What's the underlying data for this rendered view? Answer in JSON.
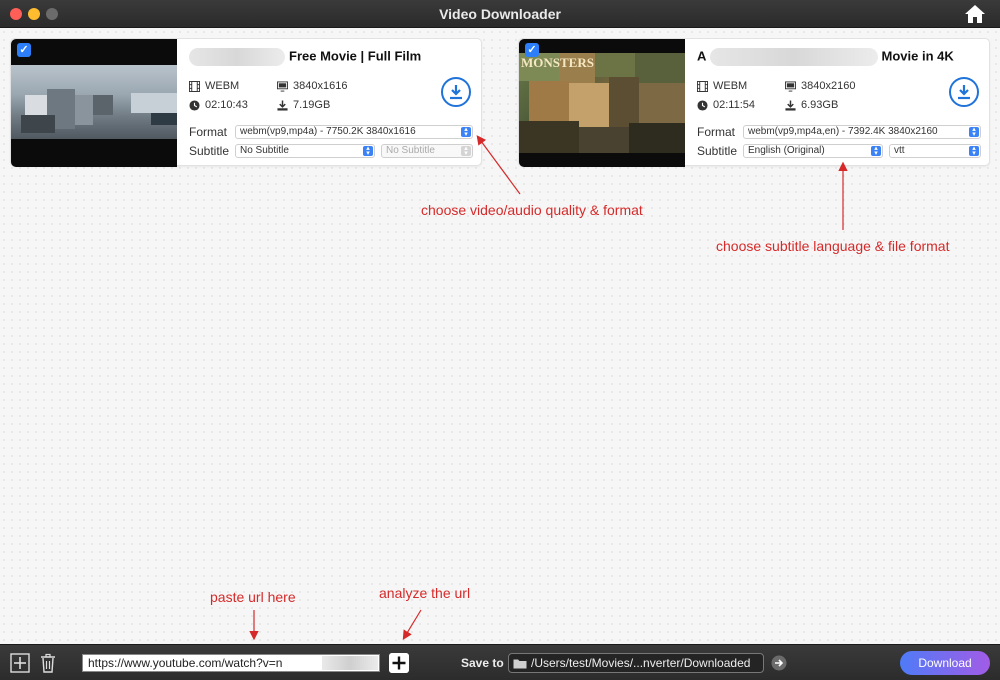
{
  "window": {
    "title": "Video Downloader"
  },
  "videos": [
    {
      "title_suffix": "Free Movie | Full Film",
      "container": "WEBM",
      "resolution": "3840x1616",
      "duration": "02:10:43",
      "size": "7.19GB",
      "format_label": "Format",
      "format_value": "webm(vp9,mp4a) - 7750.2K 3840x1616",
      "subtitle_label": "Subtitle",
      "subtitle_value": "No Subtitle",
      "subtitle_format_value": "No Subtitle",
      "checked": true
    },
    {
      "title_suffix": "Movie in 4K",
      "title_prefix": "A",
      "container": "WEBM",
      "resolution": "3840x2160",
      "duration": "02:11:54",
      "size": "6.93GB",
      "format_label": "Format",
      "format_value": "webm(vp9,mp4a,en) - 7392.4K 3840x2160",
      "subtitle_label": "Subtitle",
      "subtitle_value": "English (Original)",
      "subtitle_format_value": "vtt",
      "checked": true,
      "thumb_text": "MONSTERS"
    }
  ],
  "annotations": {
    "quality": "choose video/audio quality & format",
    "subtitle": "choose subtitle language & file format",
    "paste": "paste url here",
    "analyze": "analyze the url"
  },
  "bottom": {
    "url_value": "https://www.youtube.com/watch?v=n",
    "save_to_label": "Save to",
    "save_path": "/Users/test/Movies/...nverter/Downloaded",
    "download_label": "Download"
  },
  "colors": {
    "accent": "#1f73d9",
    "annotation": "#d62a2a",
    "checkbox": "#2d7ff9"
  },
  "icons": [
    "home-icon",
    "film-icon",
    "monitor-icon",
    "clock-icon",
    "download-size-icon",
    "download-icon",
    "add-icon",
    "trash-icon",
    "plus-icon",
    "folder-icon",
    "arrow-right-icon"
  ]
}
